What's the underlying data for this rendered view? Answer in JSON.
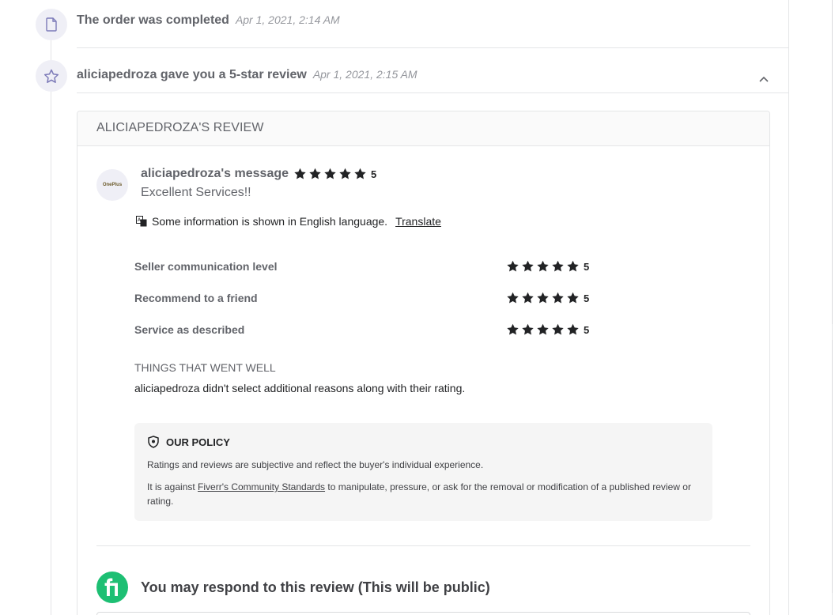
{
  "events": [
    {
      "title": "The order was completed",
      "time": "Apr 1, 2021, 2:14 AM",
      "icon": "document-icon"
    },
    {
      "title": "aliciapedroza gave you a 5-star review",
      "time": "Apr 1, 2021, 2:15 AM",
      "icon": "star-outline-icon"
    }
  ],
  "review": {
    "header": "ALICIAPEDROZA'S REVIEW",
    "avatar_text": "OnePlus",
    "message_name": "aliciapedroza's message",
    "overall_rating": "5",
    "message": "Excellent Services!!",
    "translate_notice": "Some information is shown in English language.",
    "translate_link": "Translate",
    "criteria": [
      {
        "label": "Seller communication level",
        "rating": "5"
      },
      {
        "label": "Recommend to a friend",
        "rating": "5"
      },
      {
        "label": "Service as described",
        "rating": "5"
      }
    ],
    "went_well_title": "THINGS THAT WENT WELL",
    "went_well_text": "aliciapedroza didn't select additional reasons along with their rating.",
    "policy": {
      "title": "OUR POLICY",
      "text1": "Ratings and reviews are subjective and reflect the buyer's individual experience.",
      "text2_before": "It is against ",
      "text2_link": "Fiverr's Community Standards",
      "text2_after": " to manipulate, pressure, or ask for the removal or modification of a published review or rating."
    },
    "respond_text": "You may respond to this review (This will be public)"
  },
  "colors": {
    "brand_green": "#1dbf73",
    "star": "#222325",
    "icon_bg": "#efeff6",
    "icon_purple": "#7c7ab8"
  }
}
